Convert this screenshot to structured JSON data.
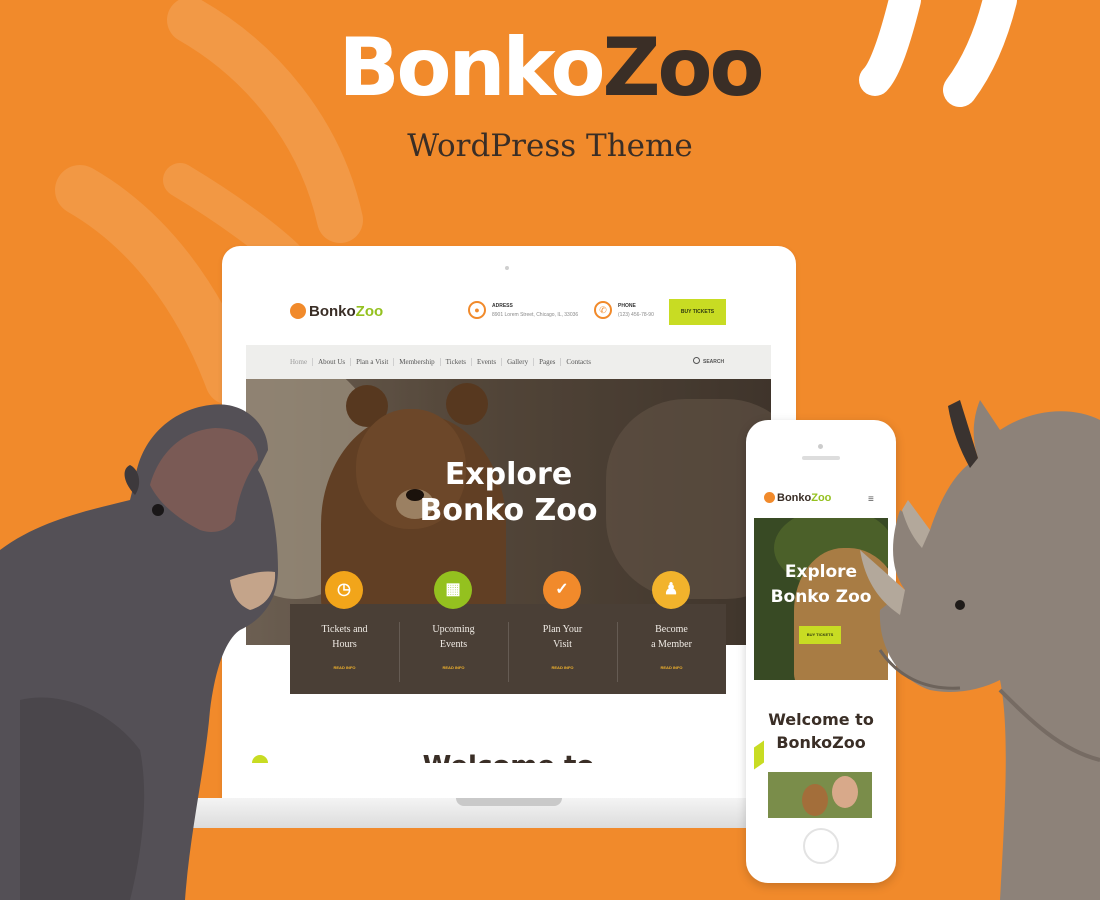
{
  "banner": {
    "brand_part1": "Bonko",
    "brand_part2": "Zoo",
    "subtitle": "WordPress Theme"
  },
  "colors": {
    "background": "#f18a2b",
    "accent_green": "#c8dc23",
    "dark_text": "#3a2e26",
    "tile_dark": "#4a3f36"
  },
  "desktop": {
    "logo_part1": "Bonko",
    "logo_part2": "Zoo",
    "address_title": "ADRESS",
    "address_text": "8901 Lorem Street, Chicago, IL, 33036",
    "phone_title": "PHONE",
    "phone_text": "(123) 456-78-90",
    "buy_label": "BUY TICKETS",
    "nav": [
      "Home",
      "About Us",
      "Plan a Visit",
      "Membership",
      "Tickets",
      "Events",
      "Gallery",
      "Pages",
      "Contacts"
    ],
    "search_label": "SEARCH",
    "hero_title_line1": "Explore",
    "hero_title_line2": "Bonko Zoo",
    "tiles": [
      {
        "line1": "Tickets and",
        "line2": "Hours",
        "more": "READ INFO",
        "icon": "clock-icon",
        "color": "#f2a51a"
      },
      {
        "line1": "Upcoming",
        "line2": "Events",
        "more": "READ INFO",
        "icon": "calendar-icon",
        "color": "#94c11f"
      },
      {
        "line1": "Plan Your",
        "line2": "Visit",
        "more": "READ INFO",
        "icon": "check-icon",
        "color": "#f18a2b"
      },
      {
        "line1": "Become",
        "line2": "a Member",
        "more": "READ INFO",
        "icon": "member-icon",
        "color": "#f2b32c"
      }
    ],
    "welcome_partial": "Welcome to"
  },
  "mobile": {
    "logo_part1": "Bonko",
    "logo_part2": "Zoo",
    "hero_line1": "Explore",
    "hero_line2": "Bonko Zoo",
    "buy_label": "BUY TICKETS",
    "welcome_line1": "Welcome to",
    "welcome_line2": "BonkoZoo"
  }
}
